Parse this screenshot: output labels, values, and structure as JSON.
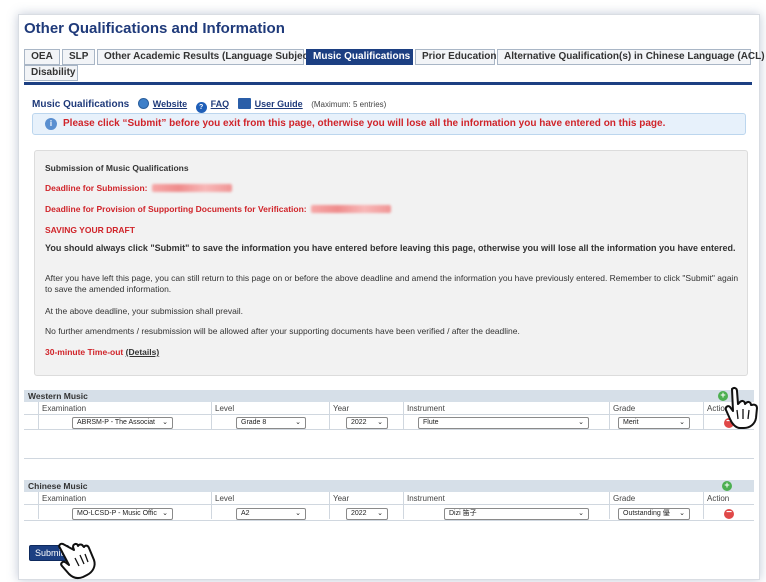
{
  "page": {
    "title": "Other Qualifications and Information"
  },
  "tabs": [
    {
      "label": "OEA"
    },
    {
      "label": "SLP"
    },
    {
      "label": "Other Academic Results (Language Subjects)"
    },
    {
      "label": "Music Qualifications",
      "active": true
    },
    {
      "label": "Prior Education"
    },
    {
      "label": "Alternative Qualification(s) in Chinese Language (ACL)"
    },
    {
      "label": "Disability"
    }
  ],
  "music_header": {
    "title": "Music Qualifications",
    "website": "Website",
    "faq": "FAQ",
    "user_guide": "User Guide",
    "max_entries": "(Maximum: 5 entries)"
  },
  "alert": {
    "text": "Please click “Submit” before you exit from this page, otherwise you will lose all the information you have entered on this page."
  },
  "draft_box": {
    "heading": "Submission of Music Qualifications",
    "deadline_submission": "Deadline for Submission:",
    "deadline_docs": "Deadline for Provision of Supporting Documents for Verification:",
    "saving": "SAVING YOUR DRAFT",
    "p1": "You should always click \"Submit\" to save the information you have entered before leaving this page, otherwise you will lose all the information you have entered.",
    "p2": "After you have left this page, you can still return to this page on or before the above deadline and amend the information you have previously entered. Remember to click \"Submit\" again to save the amended information.",
    "p3": "At the above deadline, your submission shall prevail.",
    "p4": "No further amendments / resubmission will be allowed after your supporting documents have been verified / after the deadline.",
    "timeout": "30-minute Time-out",
    "details": "(Details)"
  },
  "columns": {
    "examination": "Examination",
    "level": "Level",
    "year": "Year",
    "instrument": "Instrument",
    "grade": "Grade",
    "action": "Action"
  },
  "western": {
    "title": "Western Music",
    "examination": "ABRSM-P - The Associat",
    "level": "Grade 8",
    "year": "2022",
    "instrument": "Flute",
    "grade": "Merit"
  },
  "chinese": {
    "title": "Chinese Music",
    "examination": "MO-LCSD-P - Music Offic",
    "level": "A2",
    "year": "2022",
    "instrument": "Dizi 笛子",
    "grade": "Outstanding 優"
  },
  "submit": {
    "label": "Submit"
  },
  "colors": {
    "brand": "#1c3f82",
    "alert_red": "#d0242a",
    "add_green": "#4caf50",
    "remove_red": "#e04848"
  }
}
